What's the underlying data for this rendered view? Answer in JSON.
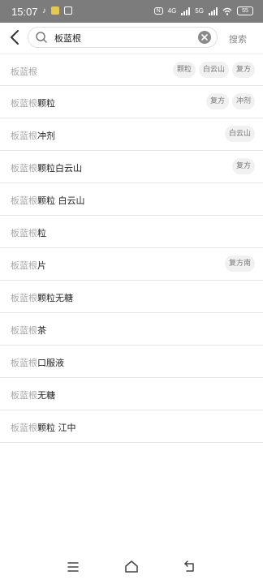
{
  "status_bar": {
    "time": "15:07",
    "nfc": "N",
    "net1": "4G",
    "net2": "5G",
    "battery": "55"
  },
  "search": {
    "value": "板蓝根",
    "button_label": "搜索"
  },
  "suggestions": [
    {
      "prefix": "板蓝根",
      "suffix": "",
      "chips": [
        "颗粒",
        "白云山",
        "复方"
      ]
    },
    {
      "prefix": "板蓝根",
      "suffix": "颗粒",
      "chips": [
        "复方",
        "冲剂"
      ]
    },
    {
      "prefix": "板蓝根",
      "suffix": "冲剂",
      "chips": [
        "白云山"
      ]
    },
    {
      "prefix": "板蓝根",
      "suffix": "颗粒白云山",
      "chips": [
        "复方"
      ]
    },
    {
      "prefix": "板蓝根",
      "suffix": "颗粒 白云山",
      "chips": []
    },
    {
      "prefix": "板蓝根",
      "suffix": "粒",
      "chips": []
    },
    {
      "prefix": "板蓝根",
      "suffix": "片",
      "chips": [
        "复方南"
      ]
    },
    {
      "prefix": "板蓝根",
      "suffix": "颗粒无糖",
      "chips": []
    },
    {
      "prefix": "板蓝根",
      "suffix": "茶",
      "chips": []
    },
    {
      "prefix": "板蓝根",
      "suffix": "口服液",
      "chips": []
    },
    {
      "prefix": "板蓝根",
      "suffix": "无糖",
      "chips": []
    },
    {
      "prefix": "板蓝根",
      "suffix": "颗粒 江中",
      "chips": []
    }
  ],
  "icons": {
    "back": "chevron-left-icon",
    "search": "search-icon",
    "clear": "clear-icon",
    "nav_menu": "menu-icon",
    "nav_home": "home-icon",
    "nav_back": "back-arrow-icon"
  },
  "colors": {
    "status_bar": "#7c7c7c",
    "prefix_text": "#a8a8a8",
    "chip_bg": "#f1f1f1"
  }
}
